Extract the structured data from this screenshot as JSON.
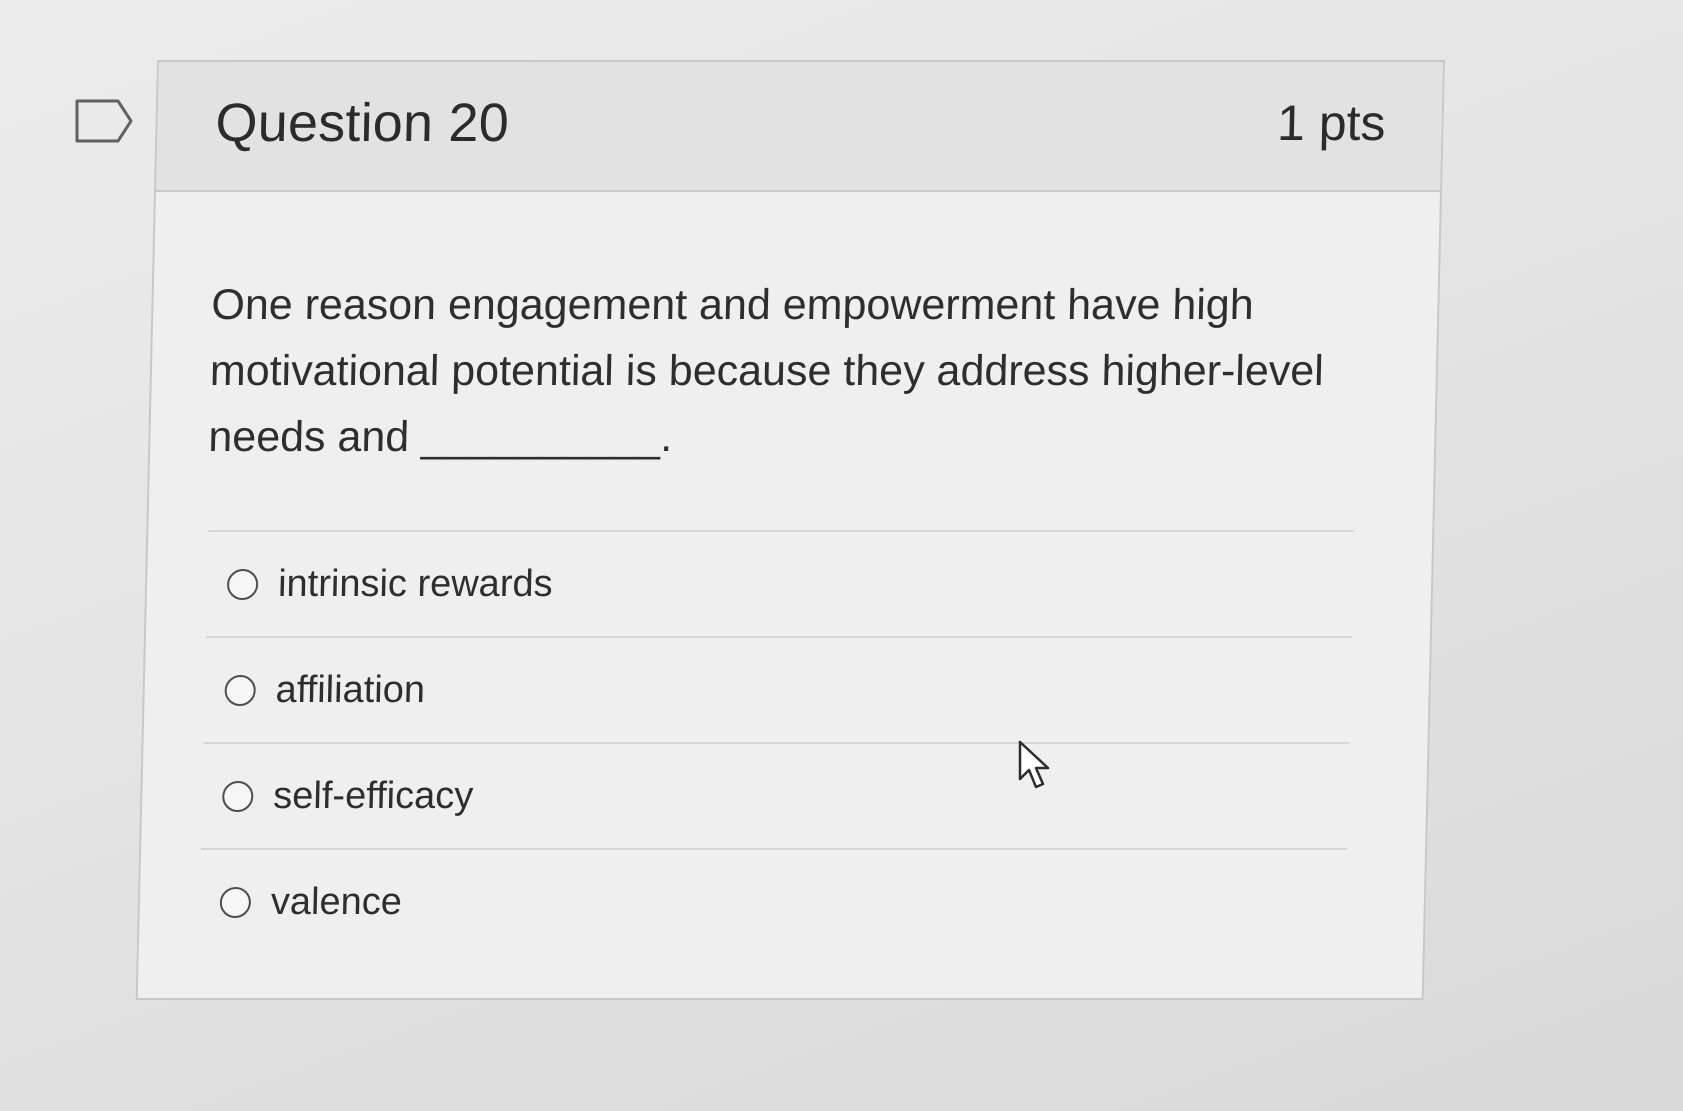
{
  "question": {
    "title": "Question 20",
    "points": "1 pts",
    "text": "One reason engagement and empowerment have high motivational potential is because they address higher-level needs and __________."
  },
  "answers": [
    {
      "label": "intrinsic rewards"
    },
    {
      "label": "affiliation"
    },
    {
      "label": "self-efficacy"
    },
    {
      "label": "valence"
    }
  ],
  "icons": {
    "flag": "flag-icon",
    "radio": "radio-unchecked-icon",
    "cursor": "mouse-pointer-icon"
  },
  "colors": {
    "header_bg": "#e2e2e2",
    "card_bg": "#efefef",
    "border": "#c8c8c8",
    "text": "#2b2b2b"
  }
}
